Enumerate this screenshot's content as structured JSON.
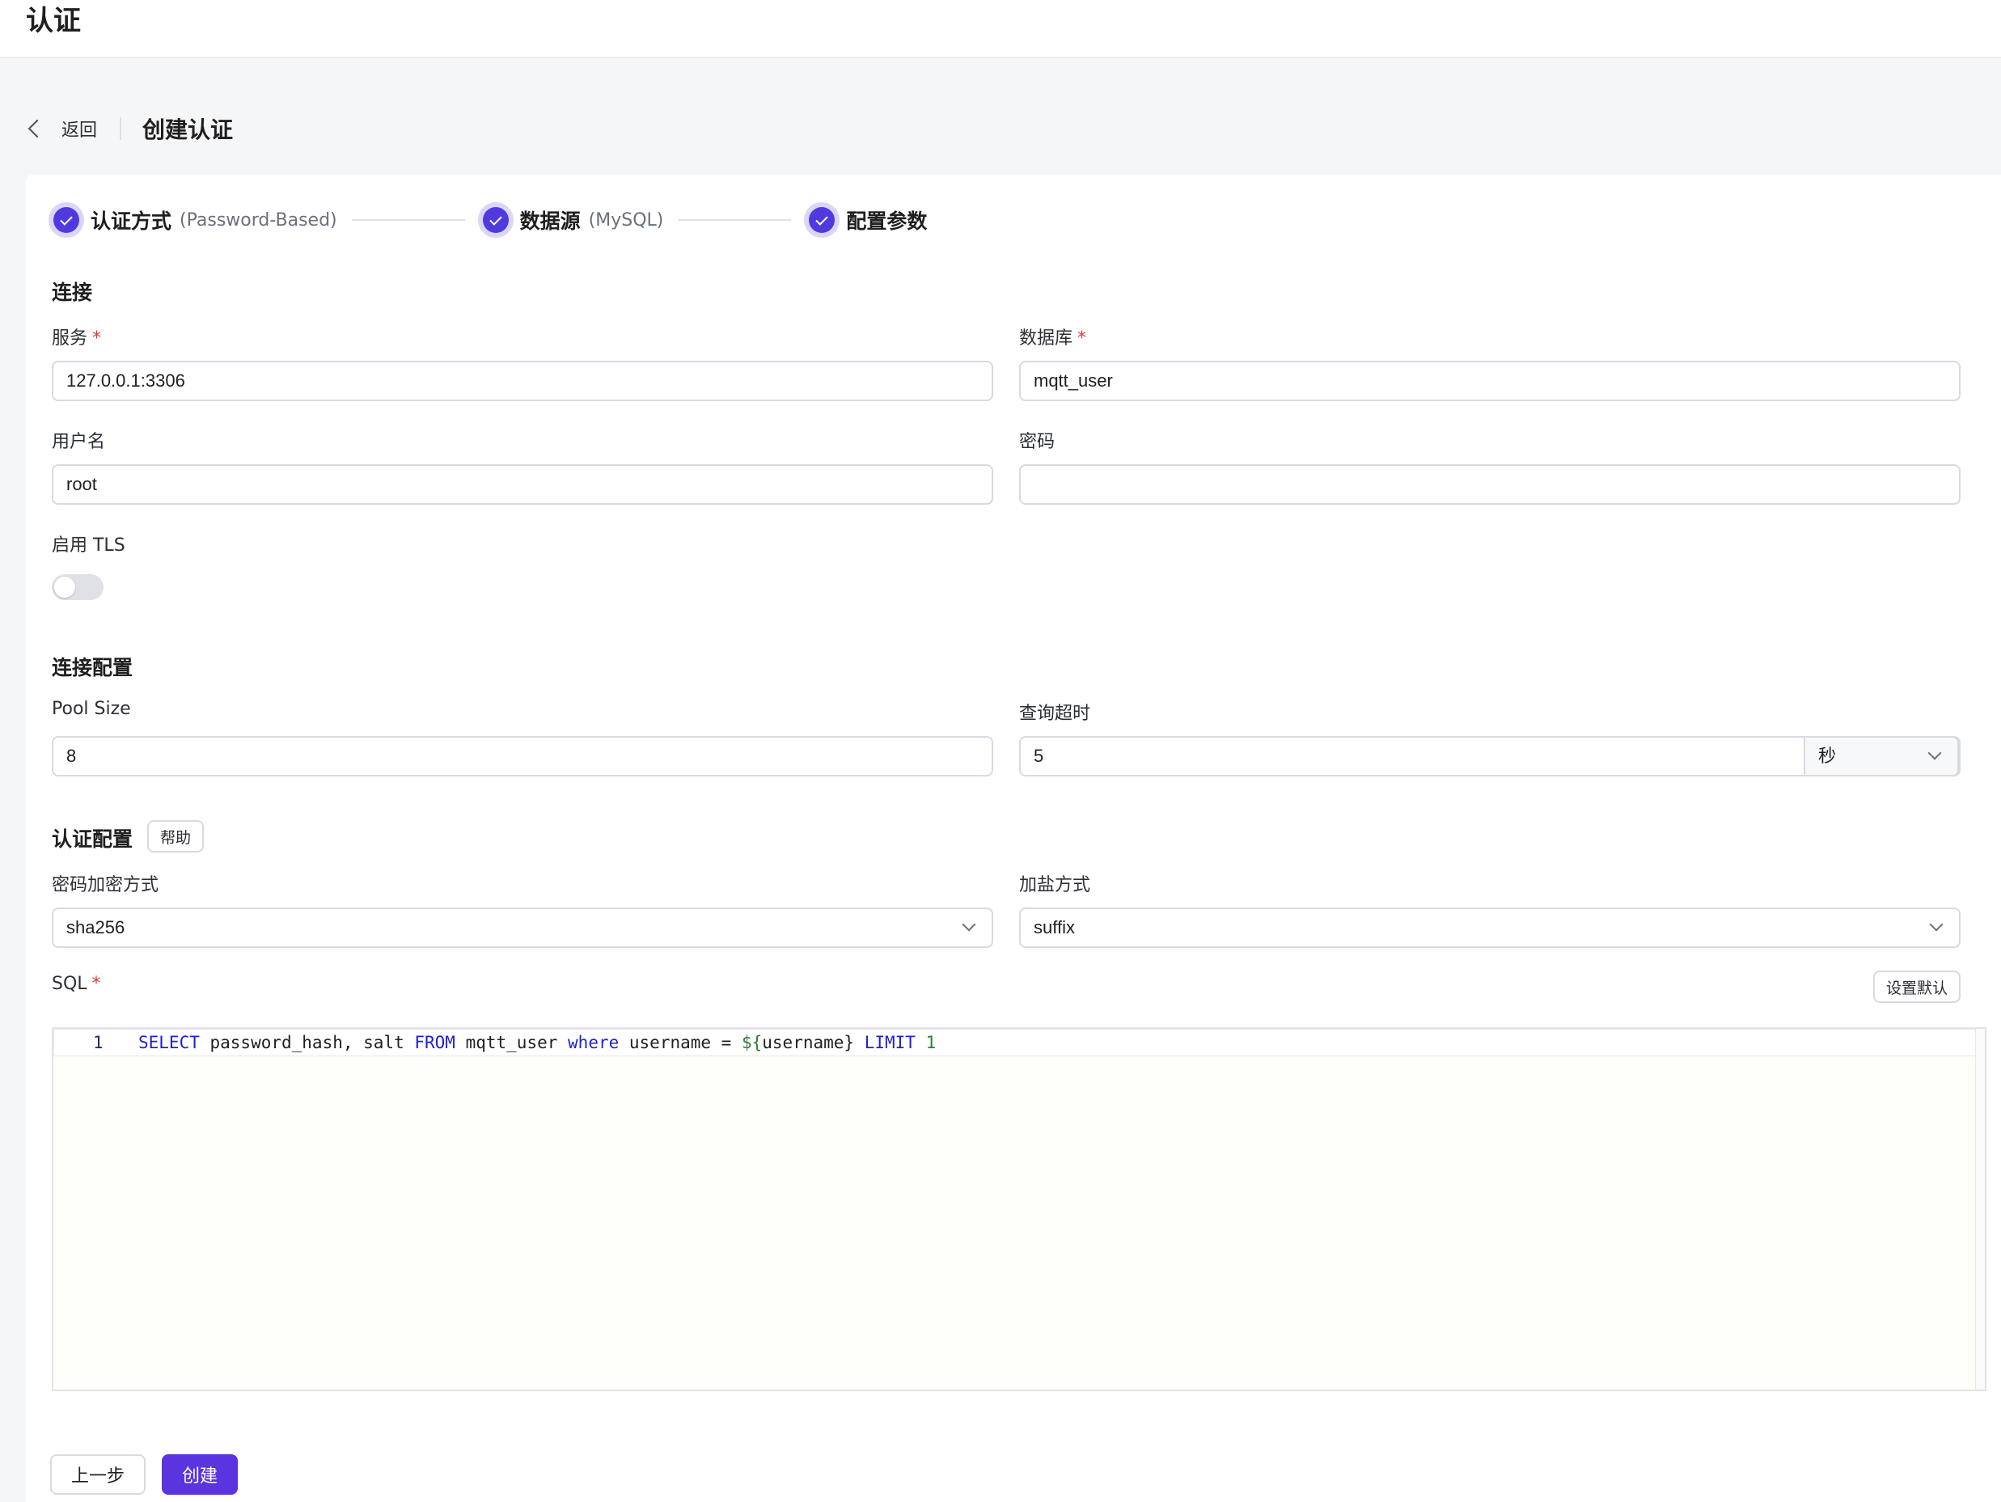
{
  "header": {
    "title": "认证"
  },
  "nav": {
    "back_label": "返回",
    "page_title": "创建认证"
  },
  "steps": [
    {
      "title": "认证方式",
      "subtitle": "(Password-Based)"
    },
    {
      "title": "数据源",
      "subtitle": "(MySQL)"
    },
    {
      "title": "配置参数",
      "subtitle": ""
    }
  ],
  "connection": {
    "section_title": "连接",
    "server_label": "服务",
    "server_value": "127.0.0.1:3306",
    "database_label": "数据库",
    "database_value": "mqtt_user",
    "username_label": "用户名",
    "username_value": "root",
    "password_label": "密码",
    "password_value": "",
    "tls_label": "启用 TLS",
    "tls_enabled": false,
    "required_mark": "*"
  },
  "connection_config": {
    "section_title": "连接配置",
    "pool_size_label": "Pool Size",
    "pool_size_value": "8",
    "query_timeout_label": "查询超时",
    "query_timeout_value": "5",
    "query_timeout_unit": "秒"
  },
  "auth_config": {
    "section_title": "认证配置",
    "help_label": "帮助",
    "password_hash_label": "密码加密方式",
    "password_hash_value": "sha256",
    "salt_position_label": "加盐方式",
    "salt_position_value": "suffix",
    "sql_label": "SQL",
    "set_default_label": "设置默认",
    "sql_line_number": "1",
    "sql_tokens": {
      "select": "SELECT",
      "cols": " password_hash, salt ",
      "from": "FROM",
      "table": " mqtt_user ",
      "where": "where",
      "cond": " username = ",
      "tpl": "${",
      "tpl_var": "username} ",
      "limit": "LIMIT",
      "space": " ",
      "limit_val": "1"
    }
  },
  "footer": {
    "prev_label": "上一步",
    "create_label": "创建"
  },
  "colors": {
    "accent": "#5a34de",
    "step_done": "#4f3ae0",
    "required": "#e03a3a"
  }
}
